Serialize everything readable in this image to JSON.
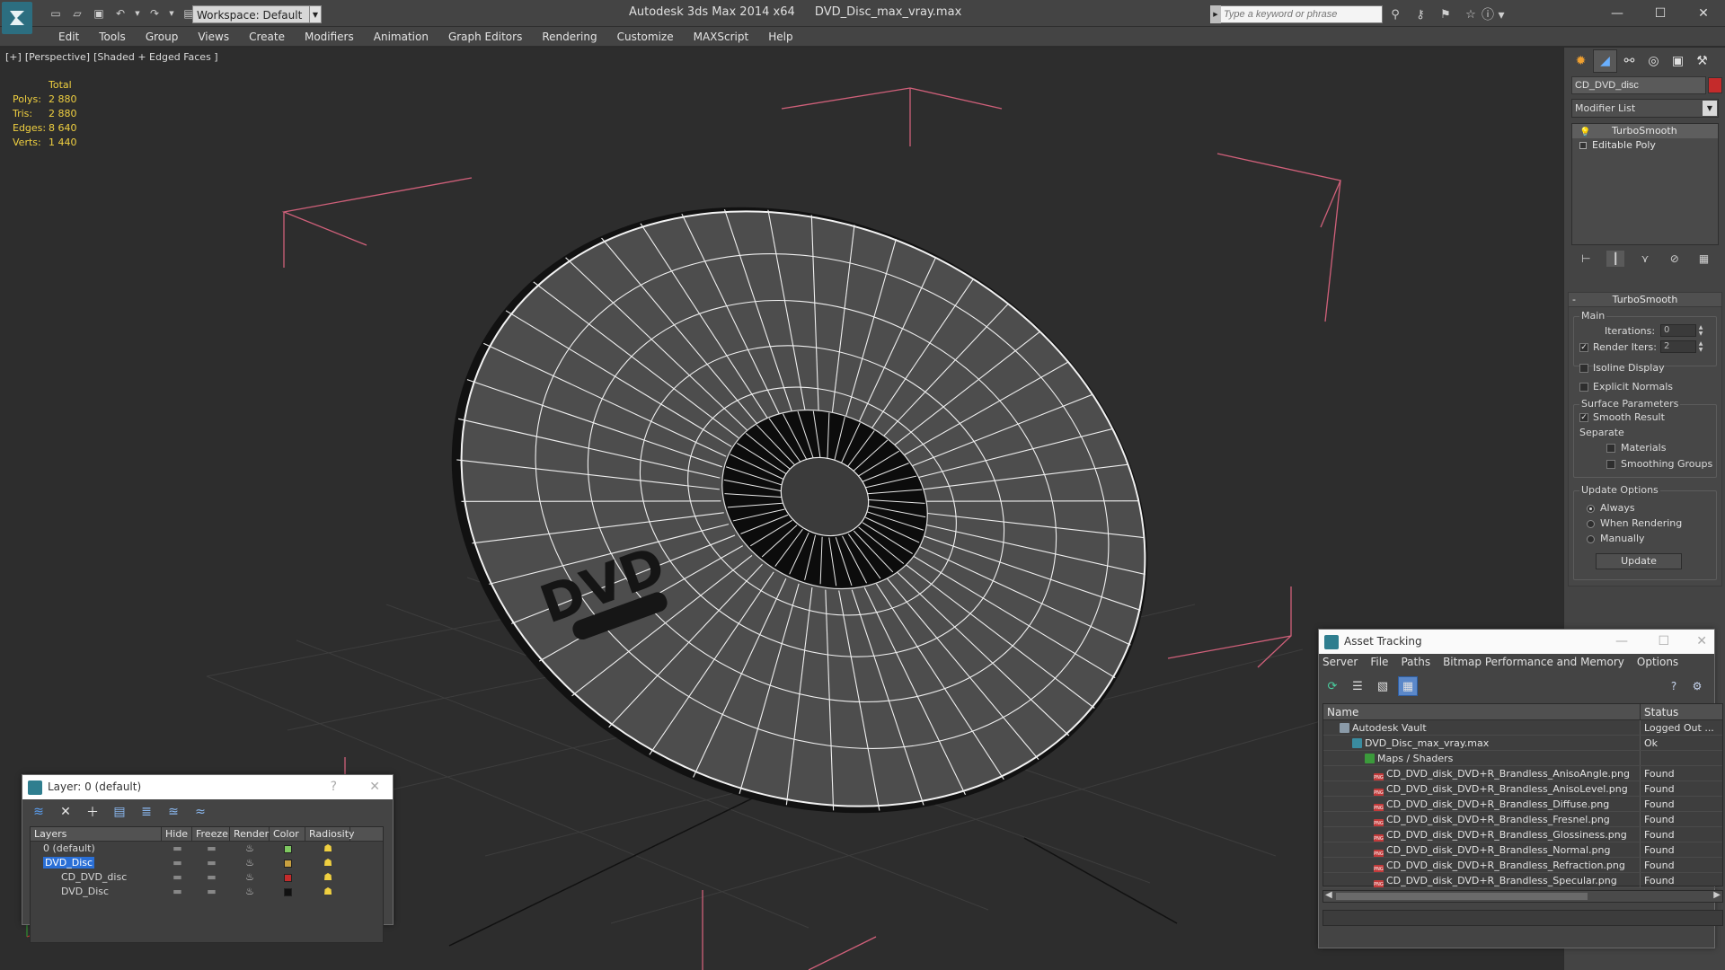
{
  "titlebar": {
    "app_name": "Autodesk 3ds Max  2014 x64",
    "file_name": "DVD_Disc_max_vray.max",
    "workspace": "Workspace: Default",
    "search_placeholder": "Type a keyword or phrase"
  },
  "menu": [
    "Edit",
    "Tools",
    "Group",
    "Views",
    "Create",
    "Modifiers",
    "Animation",
    "Graph Editors",
    "Rendering",
    "Customize",
    "MAXScript",
    "Help"
  ],
  "viewport": {
    "label_plus": "[+]",
    "label_view": "[Perspective]",
    "label_shading": "[Shaded + Edged Faces ]",
    "stats": {
      "header": "Total",
      "rows": [
        {
          "label": "Polys:",
          "value": "2 880"
        },
        {
          "label": "Tris:",
          "value": "2 880"
        },
        {
          "label": "Edges:",
          "value": "8 640"
        },
        {
          "label": "Verts:",
          "value": "1 440"
        }
      ]
    }
  },
  "command_panel": {
    "object_name": "CD_DVD_disc",
    "object_color": "#c42b2b",
    "modifier_list": "Modifier List",
    "stack": [
      "TurboSmooth",
      "Editable Poly"
    ],
    "rollout_title": "TurboSmooth",
    "main_group": "Main",
    "iterations_label": "Iterations:",
    "iterations_value": "0",
    "render_iters_label": "Render Iters:",
    "render_iters_value": "2",
    "isoline_label": "Isoline Display",
    "explicit_normals_label": "Explicit Normals",
    "surface_group": "Surface Parameters",
    "smooth_result_label": "Smooth Result",
    "separate_label": "Separate",
    "materials_label": "Materials",
    "smoothing_groups_label": "Smoothing Groups",
    "update_group": "Update Options",
    "always_label": "Always",
    "when_rendering_label": "When Rendering",
    "manually_label": "Manually",
    "update_button": "Update"
  },
  "layer_window": {
    "title": "Layer: 0 (default)",
    "help": "?",
    "close": "✕",
    "columns": [
      "Layers",
      "Hide",
      "Freeze",
      "Render",
      "Color",
      "Radiosity"
    ],
    "rows": [
      {
        "name": "0 (default)",
        "color": "#7ec860",
        "selected": false
      },
      {
        "name": "DVD_Disc",
        "color": "#c8a040",
        "selected": true
      },
      {
        "name": "CD_DVD_disc",
        "color": "#c42b2b",
        "selected": false
      },
      {
        "name": "DVD_Disc",
        "color": "#111111",
        "selected": false
      }
    ]
  },
  "asset_window": {
    "title": "Asset Tracking",
    "menu": [
      "Server",
      "File",
      "Paths",
      "Bitmap Performance and Memory",
      "Options"
    ],
    "columns": [
      "Name",
      "Status"
    ],
    "rows": [
      {
        "name": "Autodesk Vault",
        "status": "Logged Out ...",
        "icon": "vault"
      },
      {
        "name": "DVD_Disc_max_vray.max",
        "status": "Ok",
        "icon": "max"
      },
      {
        "name": "Maps / Shaders",
        "status": "",
        "icon": "maps"
      },
      {
        "name": "CD_DVD_disk_DVD+R_Brandless_AnisoAngle.png",
        "status": "Found",
        "icon": "png"
      },
      {
        "name": "CD_DVD_disk_DVD+R_Brandless_AnisoLevel.png",
        "status": "Found",
        "icon": "png"
      },
      {
        "name": "CD_DVD_disk_DVD+R_Brandless_Diffuse.png",
        "status": "Found",
        "icon": "png"
      },
      {
        "name": "CD_DVD_disk_DVD+R_Brandless_Fresnel.png",
        "status": "Found",
        "icon": "png"
      },
      {
        "name": "CD_DVD_disk_DVD+R_Brandless_Glossiness.png",
        "status": "Found",
        "icon": "png"
      },
      {
        "name": "CD_DVD_disk_DVD+R_Brandless_Normal.png",
        "status": "Found",
        "icon": "png"
      },
      {
        "name": "CD_DVD_disk_DVD+R_Brandless_Refraction.png",
        "status": "Found",
        "icon": "png"
      },
      {
        "name": "CD_DVD_disk_DVD+R_Brandless_Specular.png",
        "status": "Found",
        "icon": "png"
      }
    ]
  },
  "disc_logo": "DVD"
}
